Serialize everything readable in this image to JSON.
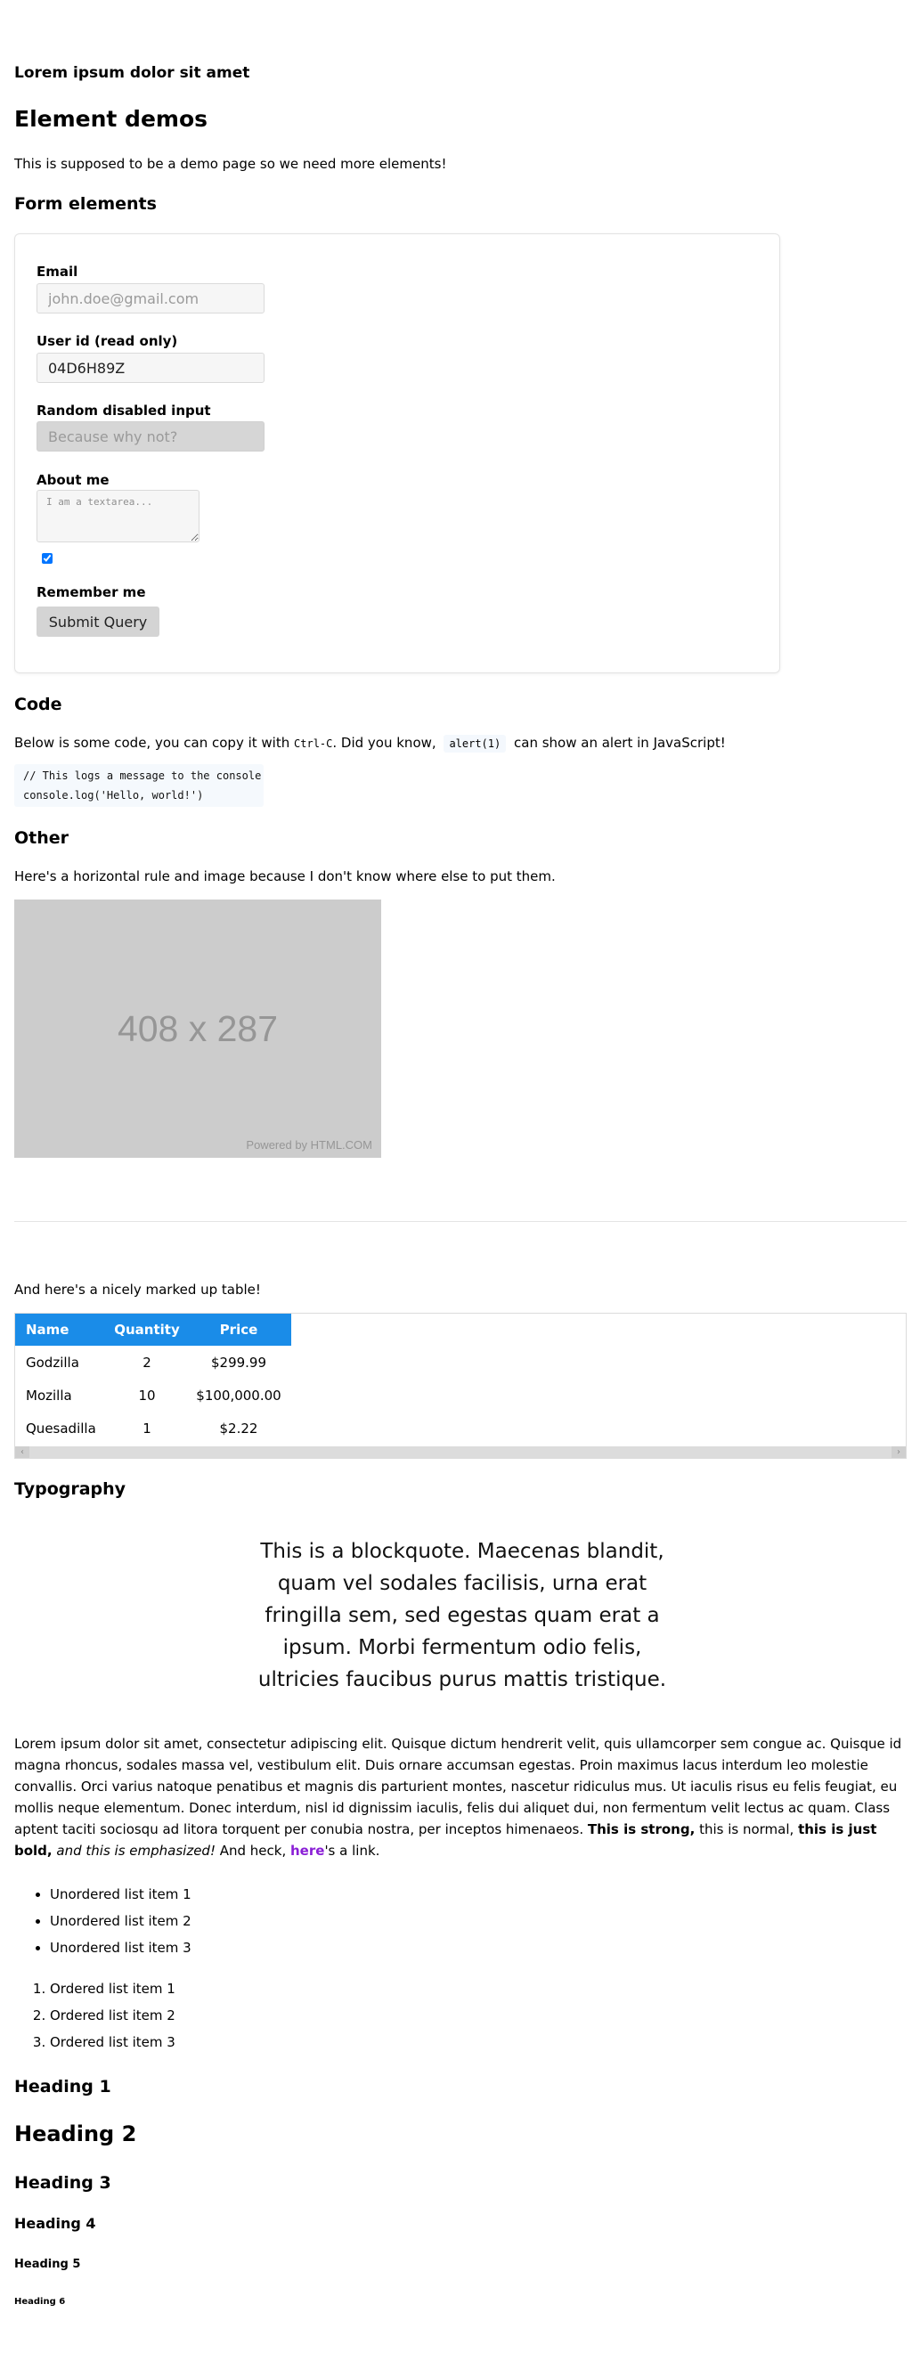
{
  "header": {
    "site_title": "Lorem ipsum dolor sit amet"
  },
  "page": {
    "title": "Element demos",
    "intro": "This is supposed to be a demo page so we need more elements!"
  },
  "form": {
    "heading": "Form elements",
    "email_label": "Email",
    "email_placeholder": "john.doe@gmail.com",
    "userid_label": "User id (read only)",
    "userid_value": "04D6H89Z",
    "disabled_label": "Random disabled input",
    "disabled_placeholder": "Because why not?",
    "about_label": "About me",
    "about_placeholder": "I am a textarea...",
    "remember_label": "Remember me",
    "remember_checked": true,
    "submit_label": "Submit Query"
  },
  "code": {
    "heading": "Code",
    "para_before": "Below is some code, you can copy it with ",
    "shortcut": "Ctrl-C",
    "para_middle": ". Did you know, ",
    "snippet": "alert(1)",
    "para_after": " can show an alert in JavaScript!",
    "block_line1": "// This logs a message to the console",
    "block_line2": "console.log('Hello, world!')"
  },
  "other": {
    "heading": "Other",
    "para": "Here's a horizontal rule and image because I don't know where else to put them.",
    "image_size_text": "408 x 287",
    "image_credit": "Powered by HTML.COM"
  },
  "table": {
    "intro": "And here's a nicely marked up table!",
    "headers": [
      "Name",
      "Quantity",
      "Price"
    ],
    "rows": [
      [
        "Godzilla",
        "2",
        "$299.99"
      ],
      [
        "Mozilla",
        "10",
        "$100,000.00"
      ],
      [
        "Quesadilla",
        "1",
        "$2.22"
      ]
    ]
  },
  "typography": {
    "heading": "Typography",
    "blockquote": "This is a blockquote. Maecenas blandit, quam vel sodales facilisis, urna erat fringilla sem, sed egestas quam erat a ipsum. Morbi fermentum odio felis, ultricies faucibus purus mattis tristique.",
    "lorem_plain": "Lorem ipsum dolor sit amet, consectetur adipiscing elit. Quisque dictum hendrerit velit, quis ullamcorper sem congue ac. Quisque id magna rhoncus, sodales massa vel, vestibulum elit. Duis ornare accumsan egestas. Proin maximus lacus interdum leo molestie convallis. Orci varius natoque penatibus et magnis dis parturient montes, nascetur ridiculus mus. Ut iaculis risus eu felis feugiat, eu mollis neque elementum. Donec interdum, nisl id dignissim iaculis, felis dui aliquet dui, non fermentum velit lectus ac quam. Class aptent taciti sociosqu ad litora torquent per conubia nostra, per inceptos himenaeos. ",
    "lorem_strong": "This is strong,",
    "lorem_normal": " this is normal, ",
    "lorem_bold": "this is just bold,",
    "lorem_em": "and this is emphasized!",
    "lorem_heck": " And heck, ",
    "link_text": "here",
    "link_tail": "'s a link.",
    "unordered": [
      "Unordered list item 1",
      "Unordered list item 2",
      "Unordered list item 3"
    ],
    "ordered": [
      "Ordered list item 1",
      "Ordered list item 2",
      "Ordered list item 3"
    ],
    "headings": [
      "Heading 1",
      "Heading 2",
      "Heading 3",
      "Heading 4",
      "Heading 5",
      "Heading 6"
    ]
  },
  "colors": {
    "table_header_bg": "#1a8ce8",
    "link": "#8a1fd6",
    "image_bg": "#cccccc"
  }
}
